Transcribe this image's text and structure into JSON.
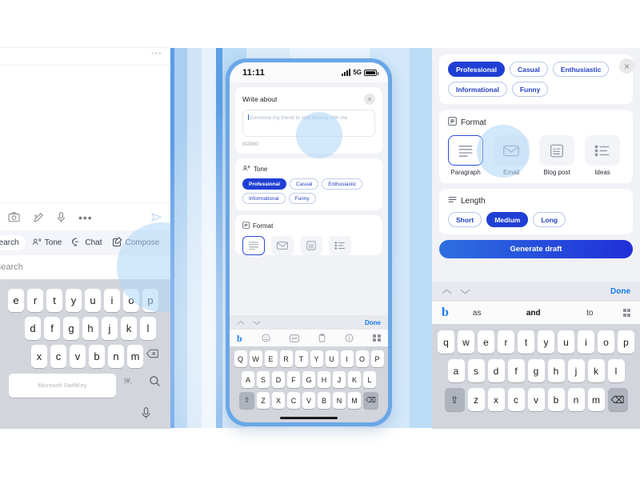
{
  "left_panel": {
    "msg_toolbar": [
      {
        "name": "camera-icon",
        "label": "Camera"
      },
      {
        "name": "edit-pen-icon",
        "label": "Edit"
      },
      {
        "name": "microphone-icon",
        "label": "Microphone"
      },
      {
        "name": "more-options-icon",
        "label": "More"
      },
      {
        "name": "send-icon",
        "label": "Send"
      }
    ],
    "features": [
      {
        "label": "Search",
        "icon": "search-icon",
        "active": true
      },
      {
        "label": "Tone",
        "icon": "tone-icon",
        "active": false
      },
      {
        "label": "Chat",
        "icon": "chat-icon",
        "active": false
      },
      {
        "label": "Compose",
        "icon": "compose-icon",
        "active": false
      }
    ],
    "search_placeholder": "Search",
    "keyboard": {
      "row1": [
        "e",
        "r",
        "t",
        "y",
        "u",
        "i",
        "o",
        "p"
      ],
      "row2": [
        "d",
        "f",
        "g",
        "h",
        "j",
        "k",
        "l"
      ],
      "row3": [
        "x",
        "c",
        "v",
        "b",
        "n",
        "m"
      ],
      "space_label": "Microsoft SwiftKey",
      "punct_label": "!#,",
      "magnifier": "search-icon",
      "mic": "microphone-icon",
      "backspace": "backspace-icon"
    }
  },
  "phone": {
    "status_bar": {
      "time": "11:11",
      "network": "5G",
      "signal": "signal-bars-icon",
      "battery": "battery-icon"
    },
    "compose_sheet": {
      "title": "Write about",
      "close_label": "×",
      "prompt_text": "Convince my friend to visit Mexico with me",
      "counter": "0/2000",
      "tone": {
        "label": "Tone",
        "icon": "tone-icon",
        "options": [
          {
            "label": "Professional",
            "selected": true
          },
          {
            "label": "Casual",
            "selected": false
          },
          {
            "label": "Enthusiastic",
            "selected": false
          },
          {
            "label": "Informational",
            "selected": false
          },
          {
            "label": "Funny",
            "selected": false
          }
        ]
      },
      "format": {
        "label": "Format",
        "icon": "format-icon",
        "options": [
          {
            "label": "Paragraph",
            "icon": "paragraph-icon",
            "selected": true
          },
          {
            "label": "Email",
            "icon": "email-icon",
            "selected": false
          },
          {
            "label": "Blog post",
            "icon": "blog-post-icon",
            "selected": false
          },
          {
            "label": "Ideas",
            "icon": "ideas-icon",
            "selected": false
          }
        ]
      }
    },
    "keyboard_bar": {
      "done_label": "Done",
      "up": "chevron-up-icon",
      "down": "chevron-down-icon"
    },
    "bing_bar": {
      "logo": "b",
      "items": [
        "emoji-icon",
        "gif-icon",
        "clipboard-icon",
        "info-icon",
        "apps-grid-icon"
      ]
    },
    "keyboard": {
      "row1": [
        "Q",
        "W",
        "E",
        "R",
        "T",
        "Y",
        "U",
        "I",
        "O",
        "P"
      ],
      "row2": [
        "A",
        "S",
        "D",
        "F",
        "G",
        "H",
        "J",
        "K",
        "L"
      ],
      "row3": [
        "Z",
        "X",
        "C",
        "V",
        "B",
        "N",
        "M"
      ],
      "shift": "shift-icon",
      "backspace": "backspace-icon"
    }
  },
  "right_panel": {
    "tone": {
      "options": [
        {
          "label": "Professional",
          "selected": true
        },
        {
          "label": "Casual",
          "selected": false
        },
        {
          "label": "Enthusiastic",
          "selected": false
        },
        {
          "label": "Informational",
          "selected": false
        },
        {
          "label": "Funny",
          "selected": false
        }
      ],
      "close_label": "×"
    },
    "format": {
      "label": "Format",
      "icon": "format-icon",
      "options": [
        {
          "label": "Paragraph",
          "icon": "paragraph-icon",
          "selected": true
        },
        {
          "label": "Email",
          "icon": "email-icon",
          "selected": false
        },
        {
          "label": "Blog post",
          "icon": "blog-post-icon",
          "selected": false
        },
        {
          "label": "Ideas",
          "icon": "ideas-icon",
          "selected": false
        }
      ]
    },
    "length": {
      "label": "Length",
      "icon": "length-icon",
      "options": [
        {
          "label": "Short",
          "selected": false
        },
        {
          "label": "Medium",
          "selected": true
        },
        {
          "label": "Long",
          "selected": false
        }
      ]
    },
    "generate_button": "Generate draft",
    "keyboard_bar": {
      "done_label": "Done",
      "up": "chevron-up-icon",
      "down": "chevron-down-icon"
    },
    "suggestions": [
      "as",
      "and",
      "to"
    ],
    "bing_logo": "b",
    "apps_grid": "apps-grid-icon",
    "keyboard": {
      "row1": [
        "q",
        "w",
        "e",
        "r",
        "t",
        "y",
        "u",
        "i",
        "o",
        "p"
      ],
      "row2": [
        "a",
        "s",
        "d",
        "f",
        "g",
        "h",
        "j",
        "k",
        "l"
      ],
      "row3": [
        "z",
        "x",
        "c",
        "v",
        "b",
        "n",
        "m"
      ],
      "shift": "shift-icon",
      "backspace": "backspace-icon"
    }
  },
  "colors": {
    "accent_blue": "#1f3fd4",
    "chip_border": "#b9c6ea",
    "phone_frame": "#6aa7e8",
    "panel_bg": "#f1f2f6",
    "link_blue": "#1579e8"
  }
}
